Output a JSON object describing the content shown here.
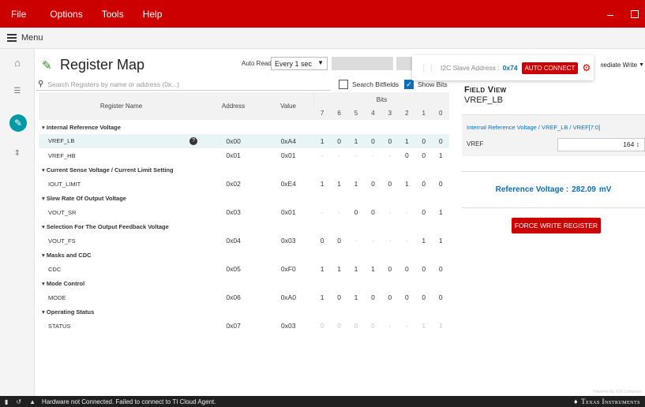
{
  "menu": [
    "File",
    "Options",
    "Tools",
    "Help"
  ],
  "menubar_label": "Menu",
  "page_title": "Register Map",
  "auto_read": {
    "label": "Auto Read",
    "value": "Every 1 sec"
  },
  "search": {
    "placeholder": "Search Registers by name or address (0x...)"
  },
  "search_bitfields": "Search Bitfields",
  "show_bits": "Show Bits",
  "columns": {
    "name": "Register Name",
    "address": "Address",
    "value": "Value",
    "bits": "Bits",
    "bit_numbers": [
      "7",
      "6",
      "5",
      "4",
      "3",
      "2",
      "1",
      "0"
    ]
  },
  "groups": [
    {
      "title": "Internal Reference Voltage",
      "rows": [
        {
          "name": "VREF_LB",
          "address": "0x00",
          "value": "0xA4",
          "bits": [
            "1",
            "0",
            "1",
            "0",
            "0",
            "1",
            "0",
            "0"
          ],
          "dim": [
            0,
            0,
            0,
            0,
            0,
            0,
            0,
            0
          ],
          "selected": true
        },
        {
          "name": "VREF_HB",
          "address": "0x01",
          "value": "0x01",
          "bits": [
            "-",
            "-",
            "-",
            "-",
            "-",
            "0",
            "0",
            "1"
          ],
          "dim": [
            1,
            1,
            1,
            1,
            1,
            0,
            0,
            0
          ]
        }
      ]
    },
    {
      "title": "Current Sense Voltage / Current Limit Setting",
      "rows": [
        {
          "name": "IOUT_LIMIT",
          "address": "0x02",
          "value": "0xE4",
          "bits": [
            "1",
            "1",
            "1",
            "0",
            "0",
            "1",
            "0",
            "0"
          ],
          "dim": [
            0,
            0,
            0,
            0,
            0,
            0,
            0,
            0
          ]
        }
      ]
    },
    {
      "title": "Slew Rate Of Output Voltage",
      "rows": [
        {
          "name": "VOUT_SR",
          "address": "0x03",
          "value": "0x01",
          "bits": [
            "-",
            "-",
            "0",
            "0",
            "-",
            "-",
            "0",
            "1"
          ],
          "dim": [
            1,
            1,
            0,
            0,
            1,
            1,
            0,
            0
          ]
        }
      ]
    },
    {
      "title": "Selection For The Output Feedback Voltage",
      "rows": [
        {
          "name": "VOUT_FS",
          "address": "0x04",
          "value": "0x03",
          "bits": [
            "0",
            "0",
            "-",
            "-",
            "-",
            "-",
            "1",
            "1"
          ],
          "dim": [
            0,
            0,
            1,
            1,
            1,
            1,
            0,
            0
          ]
        }
      ]
    },
    {
      "title": "Masks and CDC",
      "rows": [
        {
          "name": "CDC",
          "address": "0x05",
          "value": "0xF0",
          "bits": [
            "1",
            "1",
            "1",
            "1",
            "0",
            "0",
            "0",
            "0"
          ],
          "dim": [
            0,
            0,
            0,
            0,
            0,
            0,
            0,
            0
          ]
        }
      ]
    },
    {
      "title": "Mode Control",
      "rows": [
        {
          "name": "MODE",
          "address": "0x06",
          "value": "0xA0",
          "bits": [
            "1",
            "0",
            "1",
            "0",
            "0",
            "0",
            "0",
            "0"
          ],
          "dim": [
            0,
            0,
            0,
            0,
            0,
            0,
            0,
            0
          ]
        }
      ]
    },
    {
      "title": "Operating Status",
      "rows": [
        {
          "name": "STATUS",
          "address": "0x07",
          "value": "0x03",
          "bits": [
            "0",
            "0",
            "0",
            "0",
            "-",
            "-",
            "1",
            "1"
          ],
          "dim": [
            1,
            1,
            1,
            1,
            1,
            1,
            1,
            1
          ]
        }
      ]
    }
  ],
  "i2c": {
    "label": "I2C Slave Address :",
    "address": "0x74",
    "auto_connect": "AUTO CONNECT"
  },
  "write_mode": "Immediate Write",
  "field_view": {
    "title": "Field View",
    "register": "VREF_LB",
    "path": "Internal Reference Voltage / VREF_LB / VREF[7:0]",
    "field_label": "VREF",
    "field_value": "164",
    "reference_label": "Reference Voltage :",
    "reference_value": "282.09",
    "reference_unit": "mV",
    "force_write": "FORCE WRITE REGISTER"
  },
  "status": {
    "text": "Hardware not Connected.   Failed to connect to TI Cloud Agent.",
    "powered_by": "Powered By GUI Composer",
    "vendor": "Texas Instruments"
  },
  "colors": {
    "brand_red": "#cc0000",
    "accent_teal": "#0099a8",
    "link_blue": "#0d6fb8"
  }
}
